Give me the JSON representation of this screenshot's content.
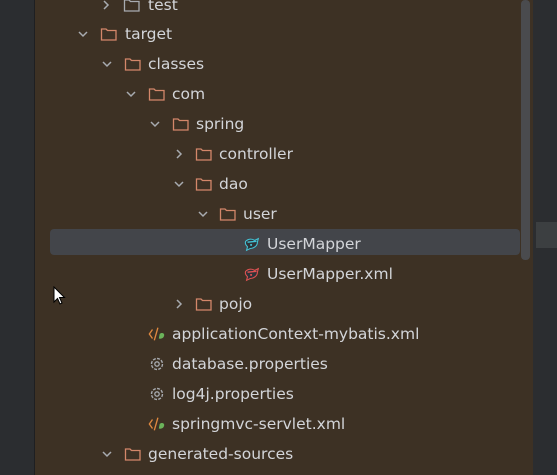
{
  "tree": {
    "rows": [
      {
        "label": "test",
        "icon": "folder-icon",
        "chevron": "collapsed",
        "selected": false
      },
      {
        "label": "target",
        "icon": "folder-icon",
        "chevron": "expanded",
        "selected": false
      },
      {
        "label": "classes",
        "icon": "folder-icon",
        "chevron": "expanded",
        "selected": false
      },
      {
        "label": "com",
        "icon": "folder-icon",
        "chevron": "expanded",
        "selected": false
      },
      {
        "label": "spring",
        "icon": "folder-icon",
        "chevron": "expanded",
        "selected": false
      },
      {
        "label": "controller",
        "icon": "folder-icon",
        "chevron": "collapsed",
        "selected": false
      },
      {
        "label": "dao",
        "icon": "folder-icon",
        "chevron": "expanded",
        "selected": false
      },
      {
        "label": "user",
        "icon": "folder-icon",
        "chevron": "expanded",
        "selected": false
      },
      {
        "label": "UserMapper",
        "icon": "mybatis-mapper-icon",
        "chevron": "none",
        "selected": true
      },
      {
        "label": "UserMapper.xml",
        "icon": "mybatis-xml-icon",
        "chevron": "none",
        "selected": false
      },
      {
        "label": "pojo",
        "icon": "folder-icon",
        "chevron": "collapsed",
        "selected": false
      },
      {
        "label": "applicationContext-mybatis.xml",
        "icon": "spring-xml-icon",
        "chevron": "none",
        "selected": false
      },
      {
        "label": "database.properties",
        "icon": "properties-gear-icon",
        "chevron": "none",
        "selected": false
      },
      {
        "label": "log4j.properties",
        "icon": "properties-gear-icon",
        "chevron": "none",
        "selected": false
      },
      {
        "label": "springmvc-servlet.xml",
        "icon": "spring-xml-icon",
        "chevron": "none",
        "selected": false
      },
      {
        "label": "generated-sources",
        "icon": "folder-icon",
        "chevron": "expanded",
        "selected": false
      }
    ]
  },
  "colors": {
    "panel_bg": "#3d3124",
    "selected_bg": "#43454a",
    "folder_stroke": "#d4876a",
    "text": "#d3d5d9"
  }
}
